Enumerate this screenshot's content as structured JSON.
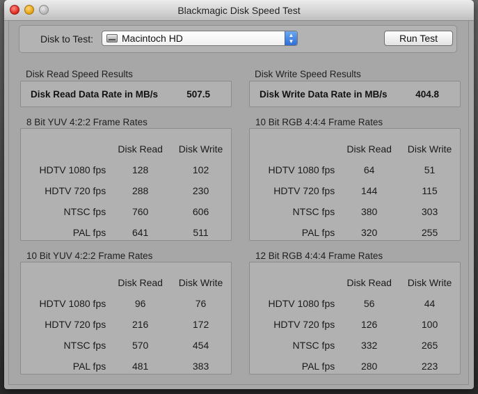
{
  "window": {
    "title": "Blackmagic Disk Speed Test"
  },
  "toolbar": {
    "disk_label": "Disk to Test:",
    "disk_value": "Macintoch HD",
    "run_label": "Run Test"
  },
  "results": {
    "read": {
      "section": "Disk Read Speed Results",
      "label": "Disk Read Data Rate in MB/s",
      "value": "507.5"
    },
    "write": {
      "section": "Disk Write Speed Results",
      "label": "Disk Write Data Rate in MB/s",
      "value": "404.8"
    }
  },
  "columns": {
    "read": "Disk Read",
    "write": "Disk Write"
  },
  "panels": [
    {
      "title": "8 Bit YUV 4:2:2 Frame Rates",
      "rows": [
        {
          "label": "HDTV 1080 fps",
          "read": "128",
          "write": "102"
        },
        {
          "label": "HDTV 720 fps",
          "read": "288",
          "write": "230"
        },
        {
          "label": "NTSC fps",
          "read": "760",
          "write": "606"
        },
        {
          "label": "PAL fps",
          "read": "641",
          "write": "511"
        }
      ]
    },
    {
      "title": "10 Bit RGB 4:4:4 Frame Rates",
      "rows": [
        {
          "label": "HDTV 1080 fps",
          "read": "64",
          "write": "51"
        },
        {
          "label": "HDTV 720 fps",
          "read": "144",
          "write": "115"
        },
        {
          "label": "NTSC fps",
          "read": "380",
          "write": "303"
        },
        {
          "label": "PAL fps",
          "read": "320",
          "write": "255"
        }
      ]
    },
    {
      "title": "10 Bit YUV 4:2:2 Frame Rates",
      "rows": [
        {
          "label": "HDTV 1080 fps",
          "read": "96",
          "write": "76"
        },
        {
          "label": "HDTV 720 fps",
          "read": "216",
          "write": "172"
        },
        {
          "label": "NTSC fps",
          "read": "570",
          "write": "454"
        },
        {
          "label": "PAL fps",
          "read": "481",
          "write": "383"
        }
      ]
    },
    {
      "title": "12 Bit RGB 4:4:4 Frame Rates",
      "rows": [
        {
          "label": "HDTV 1080 fps",
          "read": "56",
          "write": "44"
        },
        {
          "label": "HDTV 720 fps",
          "read": "126",
          "write": "100"
        },
        {
          "label": "NTSC fps",
          "read": "332",
          "write": "265"
        },
        {
          "label": "PAL fps",
          "read": "280",
          "write": "223"
        }
      ]
    }
  ]
}
